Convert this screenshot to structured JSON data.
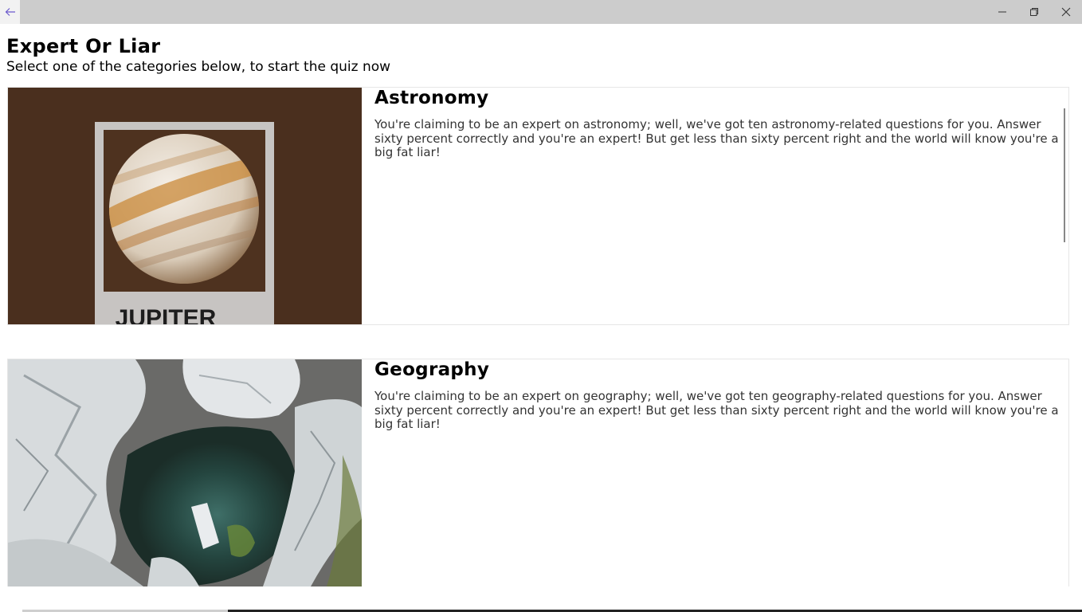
{
  "window": {
    "back_icon": "arrow-left-icon",
    "minimize_icon": "minimize-icon",
    "maximize_icon": "restore-icon",
    "close_icon": "close-icon"
  },
  "header": {
    "title": "Expert Or Liar",
    "subtitle": "Select one of the categories below, to start the quiz now"
  },
  "categories": [
    {
      "name": "Astronomy",
      "description": "You're claiming to be an expert on astronomy; well, we've got ten astronomy-related questions for you. Answer sixty percent correctly and you're an expert! But get less than sixty percent right and the world will know you're a big fat liar!",
      "image_caption": "JUPITER"
    },
    {
      "name": "Geography",
      "description": "You're claiming to be an expert on geography; well, we've got ten geography-related questions for you. Answer sixty percent correctly and you're an expert! But get less than sixty percent right and the world will know you're a big fat liar!"
    }
  ],
  "colors": {
    "accent": "#6b5acd",
    "astronomy_bg": "#4a2f1e",
    "titlebar": "#cccccc"
  }
}
